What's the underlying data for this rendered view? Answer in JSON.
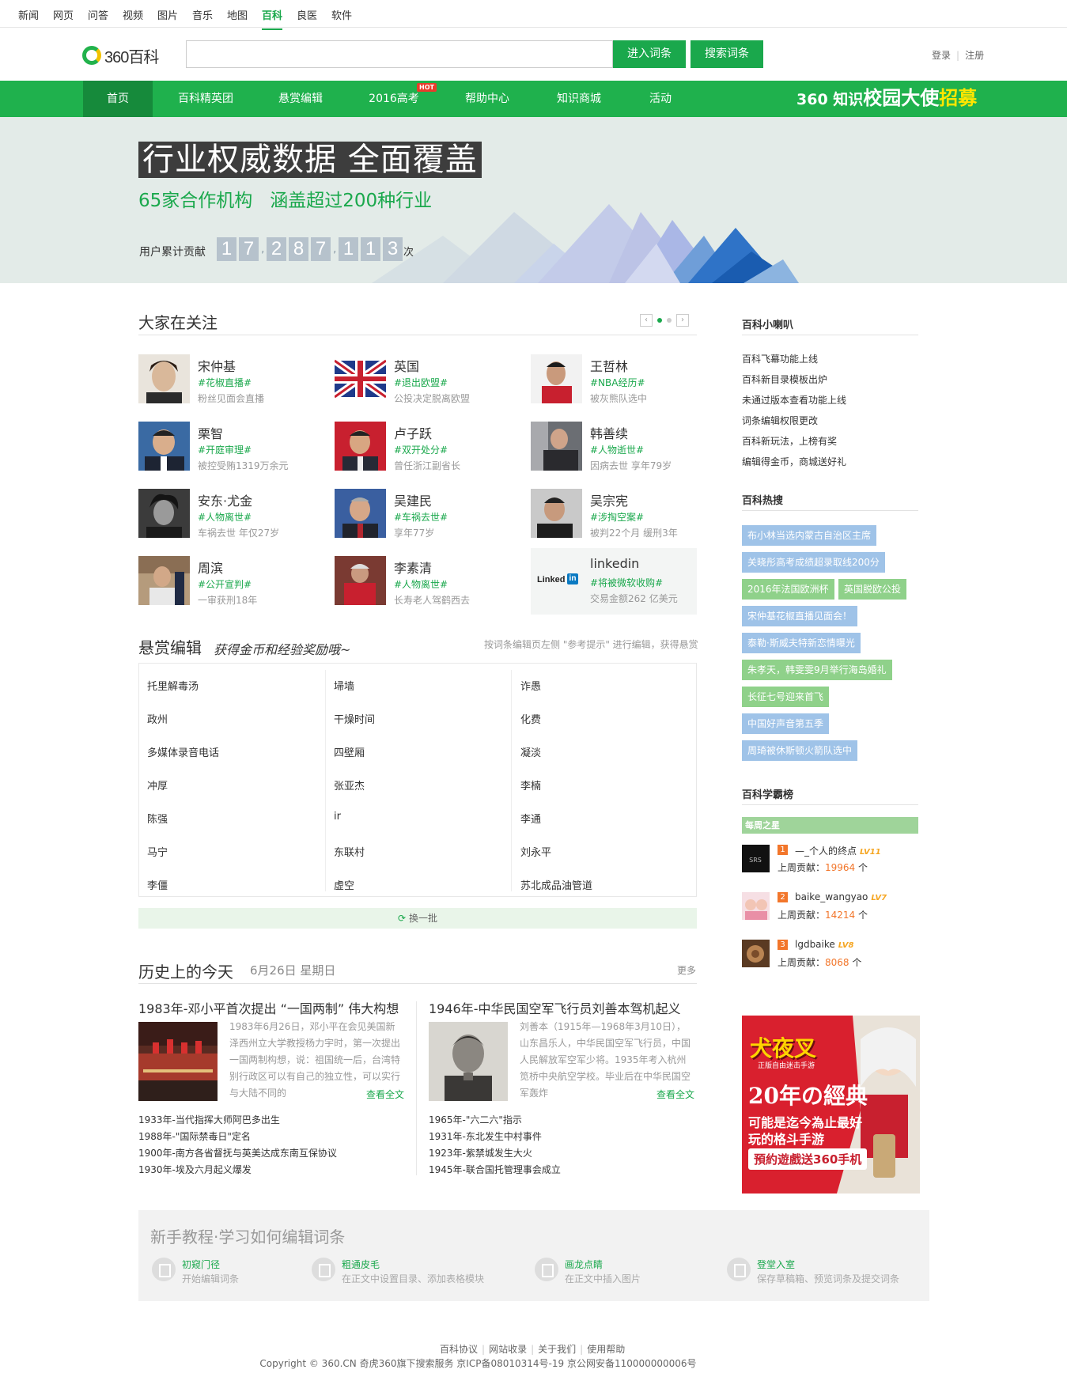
{
  "topnav": [
    "新闻",
    "网页",
    "问答",
    "视频",
    "图片",
    "音乐",
    "地图",
    "百科",
    "良医",
    "软件"
  ],
  "topnav_active": "百科",
  "logo_text": "360百科",
  "search": {
    "value": "",
    "enter_label": "进入词条",
    "search_label": "搜索词条"
  },
  "auth": {
    "login": "登录",
    "register": "注册"
  },
  "mainnav": [
    "首页",
    "百科精英团",
    "悬赏编辑",
    "2016高考",
    "帮助中心",
    "知识商城",
    "活动"
  ],
  "mainnav_hot": "HOT",
  "recruit": {
    "a": "360 知识",
    "b": "校园大使",
    "c": "招募"
  },
  "banner": {
    "title": "行业权威数据 全面覆盖",
    "sub_a": "65家合作机构",
    "sub_b": "涵盖超过200种行业",
    "counter_label": "用户累计贡献",
    "counter_digits": [
      "1",
      "7",
      "2",
      "8",
      "7",
      "1",
      "1",
      "3"
    ],
    "counter_unit": "次"
  },
  "focus": {
    "title": "大家在关注",
    "people": [
      {
        "name": "宋仲基",
        "tag": "#花椒直播#",
        "desc": "粉丝见面会直播"
      },
      {
        "name": "英国",
        "tag": "#退出欧盟#",
        "desc": "公投决定脱离欧盟"
      },
      {
        "name": "王哲林",
        "tag": "#NBA经历#",
        "desc": "被灰熊队选中"
      },
      {
        "name": "栗智",
        "tag": "#开庭审理#",
        "desc": "被控受贿1319万余元"
      },
      {
        "name": "卢子跃",
        "tag": "#双开处分#",
        "desc": "曾任浙江副省长"
      },
      {
        "name": "韩善续",
        "tag": "#人物逝世#",
        "desc": "因病去世 享年79岁"
      },
      {
        "name": "安东·尤金",
        "tag": "#人物离世#",
        "desc": "车祸去世 年仅27岁"
      },
      {
        "name": "吴建民",
        "tag": "#车祸去世#",
        "desc": "享年77岁"
      },
      {
        "name": "吴宗宪",
        "tag": "#涉掏空案#",
        "desc": "被判22个月 缓刑3年"
      },
      {
        "name": "周滨",
        "tag": "#公开宣判#",
        "desc": "一审获刑18年"
      },
      {
        "name": "李素清",
        "tag": "#人物离世#",
        "desc": "长寿老人驾鹤西去"
      },
      {
        "name": "linkedin",
        "tag": "#将被微软收购#",
        "desc": "交易金额262 亿美元"
      }
    ],
    "linkedin_logo": "Linked",
    "linkedin_logo_in": "in"
  },
  "reward": {
    "title": "悬赏编辑",
    "subtitle": "获得金币和经验奖励哦~",
    "hint": "按词条编辑页左侧 \"参考提示\" 进行编辑，获得悬赏",
    "col1": [
      "托里解毒汤",
      "政州",
      "多媒体录音电话",
      "冲厚",
      "陈强",
      "马宁",
      "李僵"
    ],
    "col2": [
      "埽墙",
      "干燥时间",
      "四壁厢",
      "张亚杰",
      "ir",
      "东联村",
      "虚空"
    ],
    "col3": [
      "诈愚",
      "化费",
      "凝淡",
      "李楠",
      "李通",
      "刘永平",
      "苏北成品油管道"
    ],
    "refresh": "换一批"
  },
  "history": {
    "title": "历史上的今天",
    "date": "6月26日 星期日",
    "more": "更多",
    "left": {
      "head": "1983年-邓小平首次提出 “一国两制” 伟大构想",
      "text": "1983年6月26日，邓小平在会见美国新泽西州立大学教授杨力宇时，第一次提出一国两制构想，说：祖国统一后，台湾特别行政区可以有自己的独立性，可以实行与大陆不同的",
      "link": "查看全文",
      "list": [
        "1933年-当代指挥大师阿巴多出生",
        "1988年-\"国际禁毒日\"定名",
        "1900年-南方各省督抚与英美达成东南互保协议",
        "1930年-埃及六月起义爆发"
      ]
    },
    "right": {
      "head": "1946年-中华民国空军飞行员刘善本驾机起义",
      "text": "刘善本（1915年—1968年3月10日），山东昌乐人，中华民国空军飞行员，中国人民解放军空军少将。1935年考入杭州笕桥中央航空学校。毕业后在中华民国空军轰炸",
      "link": "查看全文",
      "list": [
        "1965年-\"六二六\"指示",
        "1931年-东北发生中村事件",
        "1923年-紫禁城发生大火",
        "1945年-联合国托管理事会成立"
      ]
    }
  },
  "sidebar": {
    "news_title": "百科小喇叭",
    "news": [
      "百科飞幕功能上线",
      "百科新目录模板出炉",
      "未通过版本查看功能上线",
      "词条编辑权限更改",
      "百科新玩法，上榜有奖",
      "编辑得金币，商城送好礼"
    ],
    "hot_title": "百科热搜",
    "hot": [
      {
        "text": "布小林当选内蒙古自治区主席",
        "color": "blue"
      },
      {
        "text": "关晓彤高考成绩超录取线200分",
        "color": "blue"
      },
      {
        "text": "2016年法国欧洲杯",
        "color": "green"
      },
      {
        "text": "英国脱欧公投",
        "color": "green"
      },
      {
        "text": "宋仲基花椒直播见面会！",
        "color": "blue"
      },
      {
        "text": "泰勒·斯威夫特新恋情曝光",
        "color": "blue"
      },
      {
        "text": "朱孝天，韩雯雯9月举行海岛婚礼",
        "color": "green"
      },
      {
        "text": "长征七号迎来首飞",
        "color": "green"
      },
      {
        "text": "中国好声音第五季",
        "color": "blue"
      },
      {
        "text": "周琦被休斯顿火箭队选中",
        "color": "blue"
      }
    ],
    "rank_title": "百科学霸榜",
    "week_star": "每周之星",
    "contrib_label": "上周贡献：",
    "contrib_unit": "个",
    "ranks": [
      {
        "no": "1",
        "user": "—_个人的终点",
        "level": "LV11",
        "count": "19964"
      },
      {
        "no": "2",
        "user": "baike_wangyao",
        "level": "LV7",
        "count": "14214"
      },
      {
        "no": "3",
        "user": "lgdbaike",
        "level": "LV8",
        "count": "8068"
      }
    ],
    "ad": {
      "logo": "犬夜叉",
      "logo_sub": "正版自由迷击手游",
      "line1": "20年の經典",
      "line2": "可能是迄今為止最好",
      "line3": "玩的格斗手游",
      "btn": "預約遊戲送360手机"
    }
  },
  "tutorial": {
    "title": "新手教程·学习如何编辑词条",
    "items": [
      {
        "t1": "初窥门径",
        "t2": "开始编辑词条"
      },
      {
        "t1": "粗通皮毛",
        "t2": "在正文中设置目录、添加表格模块"
      },
      {
        "t1": "画龙点睛",
        "t2": "在正文中插入图片"
      },
      {
        "t1": "登堂入室",
        "t2": "保存草稿箱、预览词条及提交词条"
      }
    ]
  },
  "footer": {
    "links": [
      "百科协议",
      "网站收录",
      "关于我们",
      "使用帮助"
    ],
    "copyright": "Copyright © 360.CN  奇虎360旗下搜索服务  京ICP备08010314号-19  京公网安备110000000006号"
  },
  "colors": {
    "brand_green": "#1fb14d",
    "accent_orange": "#f2762b",
    "tag_blue": "#9fc3e8",
    "tag_green": "#8fd18a"
  }
}
